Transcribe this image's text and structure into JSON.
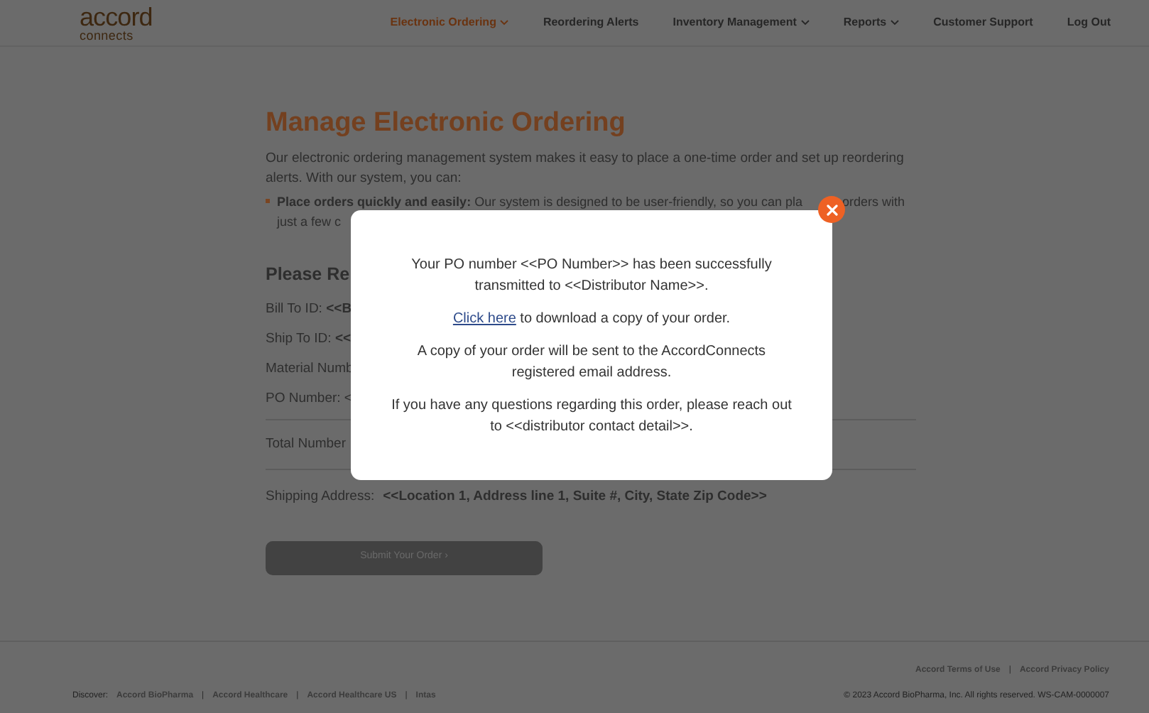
{
  "header": {
    "logo": {
      "line1": "accord",
      "line2": "connects"
    },
    "nav": [
      {
        "label": "Electronic Ordering",
        "selected": true,
        "has_menu": true
      },
      {
        "label": "Reordering Alerts",
        "selected": false,
        "has_menu": false
      },
      {
        "label": "Inventory Management",
        "selected": false,
        "has_menu": true
      },
      {
        "label": "Reports",
        "selected": false,
        "has_menu": true
      },
      {
        "label": "Customer Support",
        "selected": false,
        "has_menu": false
      },
      {
        "label": "Log Out",
        "selected": false,
        "has_menu": false
      }
    ]
  },
  "page": {
    "title": "Manage Electronic Ordering",
    "intro": "Our electronic ordering management system makes it easy to place a one-time order and set up reordering alerts. With our system, you can:",
    "bullet": {
      "text": "**Place orders quickly and easily:** Our system is designed to be user-friendly, so you can pla",
      "after_close": "orders with",
      "second_line": "just a few c"
    },
    "review_heading": "Please Re",
    "fields": [
      "Bill To ID: **<<B**",
      "Ship To ID: **<<**",
      "Material Numb",
      "PO Number: <"
    ],
    "total_label": "Total Number",
    "shipping": {
      "label": "Shipping Address:",
      "value": "<<Location 1, Address line 1, Suite #, City, State Zip Code>>"
    },
    "submit_button": "Submit Your Order ›"
  },
  "modal": {
    "message": "Your PO number <<PO Number>> has been successfully transmitted to <<Distributor Name>>.",
    "link": "Click here",
    "link_rest": " to download a copy of your order.",
    "copy_note": "A copy of your order will be sent to the AccordConnects registered email address.",
    "contact_note": "If you have any questions regarding this order, please reach out to <<distributor contact detail>>."
  },
  "footer": {
    "discover_label": "Discover:",
    "separator": "|",
    "links": [
      "Accord BioPharma",
      "Accord Healthcare",
      "Accord Healthcare US",
      "Intas"
    ],
    "legal_links": [
      "Accord Terms of Use",
      "Accord Privacy Policy"
    ],
    "copyright": "© 2023 Accord BioPharma, Inc. All rights reserved. WS-CAM-0000007"
  }
}
